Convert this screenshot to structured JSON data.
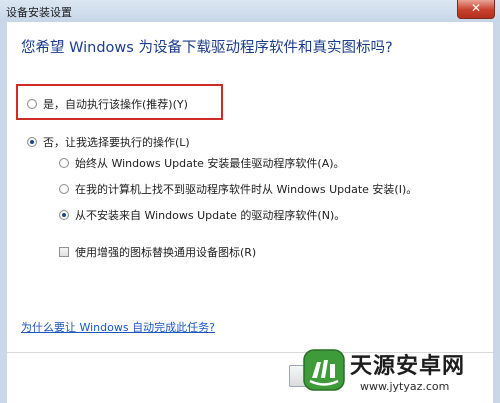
{
  "window": {
    "title": "设备安装设置",
    "close_label": "✕"
  },
  "dialog": {
    "question": "您希望 Windows 为设备下载驱动程序软件和真实图标吗?",
    "options": {
      "auto": "是，自动执行该操作(推荐)(Y)",
      "manual": "否，让我选择要执行的操作(L)",
      "sub_always": "始终从 Windows Update 安装最佳驱动程序软件(A)。",
      "sub_if_missing": "在我的计算机上找不到驱动程序软件时从 Windows Update 安装(I)。",
      "sub_never": "从不安装来自 Windows Update 的驱动程序软件(N)。",
      "enhanced_icons": "使用增强的图标替换通用设备图标(R)"
    },
    "link": "为什么要让 Windows 自动完成此任务?"
  },
  "watermark": {
    "title": "天源安卓网",
    "url": "www.jytyaz.com"
  },
  "colors": {
    "question_blue": "#1a3e8c",
    "link_blue": "#1a56c2",
    "highlight_red": "#d12b26"
  }
}
